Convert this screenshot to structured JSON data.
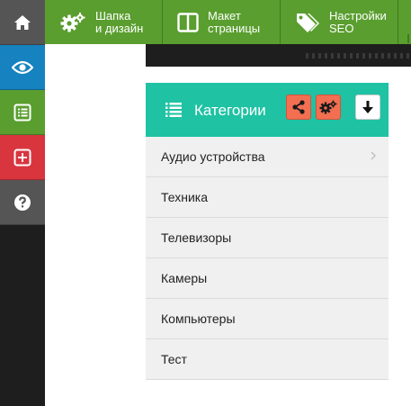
{
  "colors": {
    "sidebar_bg": "#1e1e1e",
    "home": "#555555",
    "view": "#1682bf",
    "content": "#5a9e2f",
    "add": "#d9353f",
    "help": "#555555",
    "topbar_green": "#5a9e2f",
    "widget_header": "#1fc2a3",
    "widget_action": "#f26f52"
  },
  "sidebar": {
    "items": [
      {
        "icon": "home-icon"
      },
      {
        "icon": "eye-icon"
      },
      {
        "icon": "list-icon"
      },
      {
        "icon": "plus-square-icon"
      },
      {
        "icon": "question-circle-icon"
      }
    ]
  },
  "topbar": {
    "buttons": [
      {
        "icon": "gears-icon",
        "label": "Шапка\nи дизайн"
      },
      {
        "icon": "layout-columns-icon",
        "label": "Макет\nстраницы"
      },
      {
        "icon": "tags-icon",
        "label": "Настройки\nSEO"
      },
      {
        "icon": "more-icon",
        "label": ""
      }
    ]
  },
  "widget": {
    "title": "Категории",
    "header_icons": [
      "list-menu-icon",
      "share-icon",
      "gears-icon",
      "arrow-down-icon"
    ],
    "categories": [
      {
        "label": "Аудио устройства",
        "has_children": true
      },
      {
        "label": "Техника",
        "has_children": false
      },
      {
        "label": "Телевизоры",
        "has_children": false
      },
      {
        "label": "Камеры",
        "has_children": false
      },
      {
        "label": "Компьютеры",
        "has_children": false
      },
      {
        "label": "Тест",
        "has_children": false
      }
    ]
  }
}
